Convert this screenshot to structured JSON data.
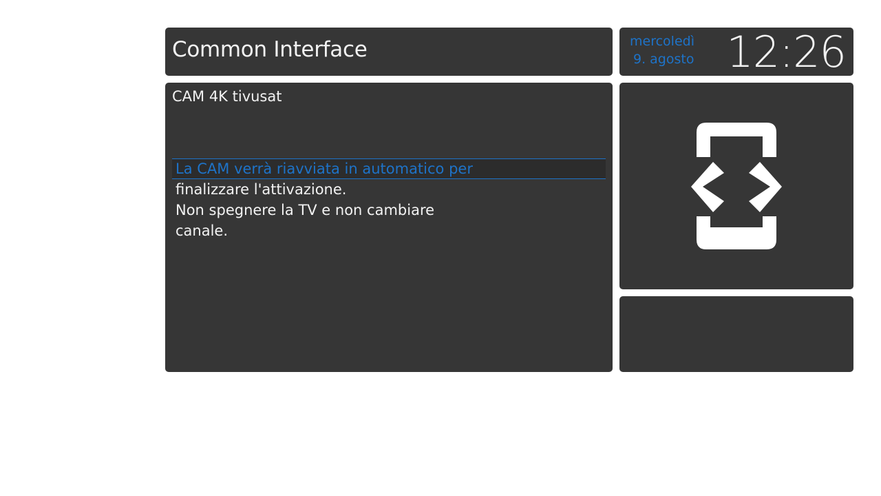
{
  "header": {
    "title": "Common Interface"
  },
  "clock": {
    "weekday": "mercoledì",
    "date": "9. agosto",
    "time": "12:26"
  },
  "main": {
    "cam_name": "CAM 4K tivusat",
    "lines": [
      "La CAM verrà riavviata in automatico per",
      "finalizzare l'attivazione.",
      "Non spegnere la TV e non cambiare",
      "canale."
    ],
    "selected_index": 0
  },
  "icon_panel": {
    "icon": "common-interface-icon"
  },
  "colors": {
    "panel": "#363636",
    "accent": "#1e73c8",
    "text": "#f2f2f2",
    "background": "#ffffff"
  }
}
